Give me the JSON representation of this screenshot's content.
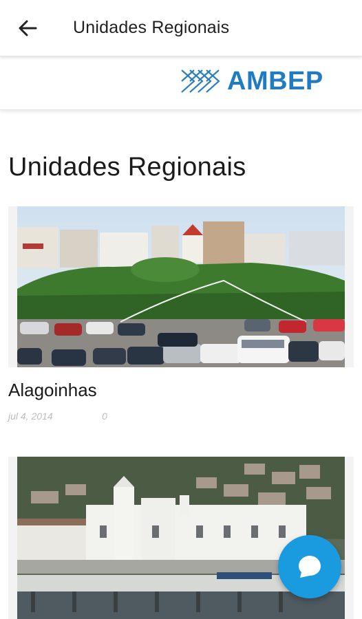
{
  "appbar": {
    "title": "Unidades Regionais",
    "back_icon": "arrow-back-icon"
  },
  "logo": {
    "text": "AMBEP",
    "icon": "ambep-logo-icon",
    "color": "#1f7cc1"
  },
  "page": {
    "heading": "Unidades Regionais"
  },
  "posts": [
    {
      "title": "Alagoinhas",
      "date": "jul 4, 2014",
      "comments": "0",
      "image": "town-square-photo"
    },
    {
      "title": "",
      "date": "",
      "comments": "",
      "image": "harbor-church-photo"
    }
  ],
  "fab": {
    "icon": "chat-bubble-icon",
    "color": "#1a9be0"
  }
}
